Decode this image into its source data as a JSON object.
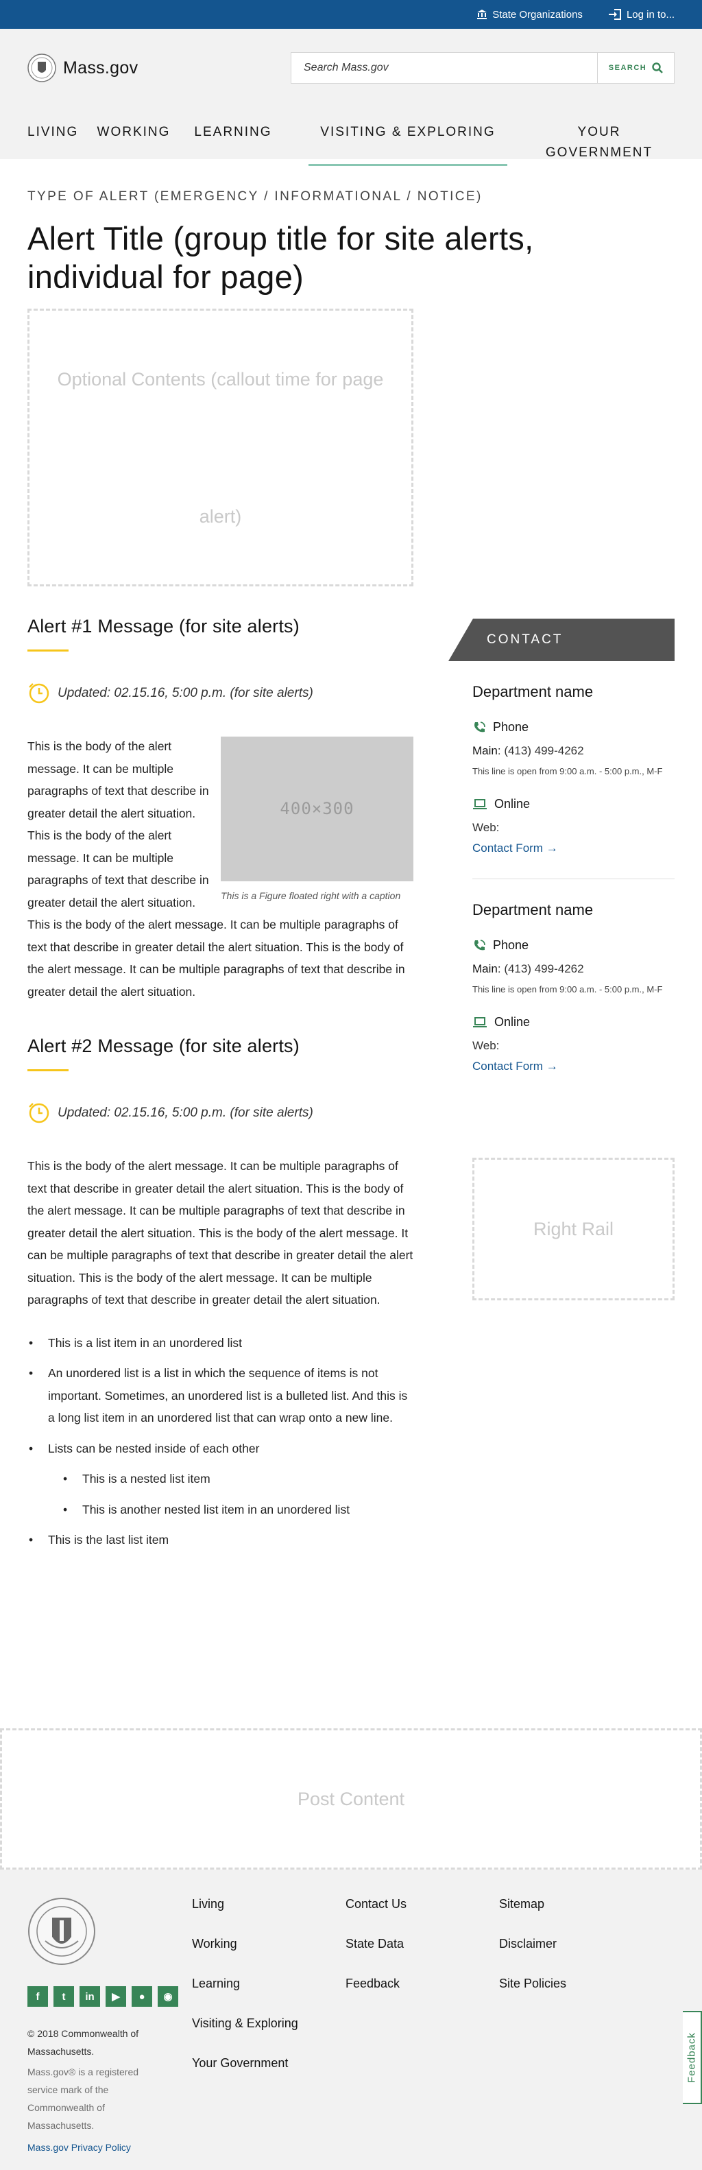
{
  "utility": {
    "state_orgs": "State Organizations",
    "login": "Log in to..."
  },
  "header": {
    "logo_text": "Mass.gov",
    "search_placeholder": "Search Mass.gov",
    "search_button": "SEARCH",
    "nav": [
      "Living",
      "Working",
      "Learning",
      "Visiting & Exploring",
      "Your Government"
    ]
  },
  "page": {
    "alert_type": "Type of Alert (Emergency / Informational / Notice)",
    "alert_title": "Alert Title (group title for site alerts, individual for page)",
    "optional_contents": "Optional Contents (callout time for page alert)"
  },
  "alerts": [
    {
      "title": "Alert #1 Message (for site alerts)",
      "updated": "Updated: 02.15.16, 5:00 p.m. (for site alerts)",
      "body": "This is the body of the alert message. It can be multiple paragraphs of text that describe in greater detail the alert situation. This is the body of the alert message. It can be multiple paragraphs of text that describe in greater detail the alert situation. This is the body of the alert message. It can be multiple paragraphs of text that describe in greater detail the alert situation. This is the body of the alert message. It can be multiple paragraphs of text that describe in greater detail the alert situation.",
      "figure_placeholder": "400×300",
      "figure_caption": "This is a Figure floated right with a caption"
    },
    {
      "title": "Alert #2 Message (for site alerts)",
      "updated": "Updated: 02.15.16, 5:00 p.m. (for site alerts)",
      "body": "This is the body of the alert message. It can be multiple paragraphs of text that describe in greater detail the alert situation. This is the body of the alert message. It can be multiple paragraphs of text that describe in greater detail the alert situation. This is the body of the alert message. It can be multiple paragraphs of text that describe in greater detail the alert situation. This is the body of the alert message. It can be multiple paragraphs of text that describe in greater detail the alert situation."
    }
  ],
  "list": {
    "item1": "This is a list item in an unordered list",
    "item2": "An unordered list is a list in which the sequence of items is not important. Sometimes, an unordered list is a bulleted list. And this is a long list item in an unordered list that can wrap onto a new line.",
    "item3": "Lists can be nested inside of each other",
    "nested1": "This is a nested list item",
    "nested2": "This is another nested list item in an unordered list",
    "item4": "This is the last list item"
  },
  "contact": {
    "heading": "CONTACT",
    "departments": [
      {
        "name": "Department name",
        "phone_label": "Phone",
        "main_label": "Main",
        "main_number": "(413) 499-4262",
        "hours": "This line is open from 9:00 a.m. - 5:00 p.m., M-F",
        "online_label": "Online",
        "web_label": "Web:",
        "link": "Contact Form"
      },
      {
        "name": "Department name",
        "phone_label": "Phone",
        "main_label": "Main",
        "main_number": "(413) 499-4262",
        "hours": "This line is open from 9:00 a.m. - 5:00 p.m., M-F",
        "online_label": "Online",
        "web_label": "Web:",
        "link": "Contact Form"
      }
    ]
  },
  "right_rail": "Right Rail",
  "post_content": "Post Content",
  "footer": {
    "col1": [
      "Living",
      "Working",
      "Learning",
      "Visiting & Exploring",
      "Your Government"
    ],
    "col2": [
      "Contact Us",
      "State Data",
      "Feedback"
    ],
    "col3": [
      "Sitemap",
      "Disclaimer",
      "Site Policies"
    ],
    "social": [
      "facebook-icon",
      "twitter-icon",
      "linkedin-icon",
      "youtube-icon",
      "rss-icon",
      "instagram-icon"
    ],
    "copyright": "© 2018 Commonwealth of Massachusetts.",
    "legal": "Mass.gov® is a registered service mark of the Commonwealth of Massachusetts.",
    "privacy": "Mass.gov Privacy Policy"
  },
  "feedback_tab": "Feedback",
  "colors": {
    "brand_blue": "#14558f",
    "accent_green": "#388557",
    "underline_gold": "#f6c51b"
  }
}
